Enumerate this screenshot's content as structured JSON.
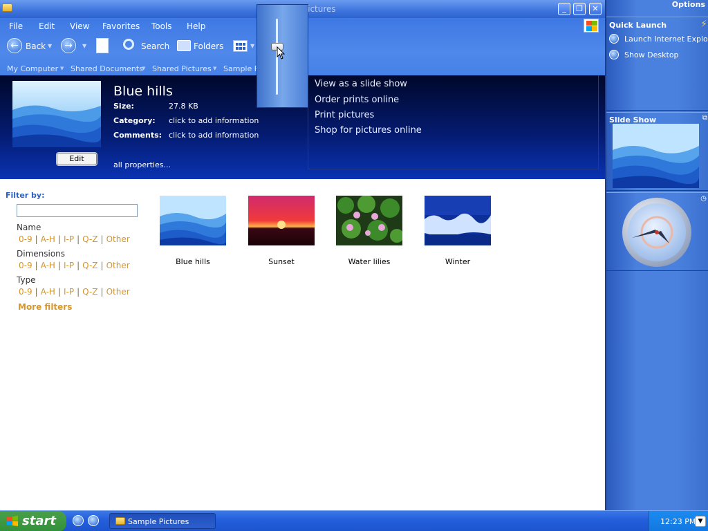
{
  "window": {
    "title": "Sample Pictures"
  },
  "menu": [
    "File",
    "Edit",
    "View",
    "Favorites",
    "Tools",
    "Help"
  ],
  "toolbar": {
    "back_label": "Back",
    "search_label": "Search",
    "folders_label": "Folders"
  },
  "address": [
    "My Computer",
    "Shared Documents",
    "Shared Pictures",
    "Sample Pictures"
  ],
  "details": {
    "title": "Blue hills",
    "size_label": "Size:",
    "size_value": "27.8 KB",
    "category_label": "Category:",
    "category_value": "click to add information",
    "comments_label": "Comments:",
    "comments_value": "click to add information",
    "edit_label": "Edit",
    "all_properties": "all properties..."
  },
  "tasks": [
    "View as a slide show",
    "Order prints online",
    "Print pictures",
    "Shop for pictures online"
  ],
  "filters": {
    "title": "Filter by:",
    "groups": [
      {
        "name": "Name",
        "options": [
          "0-9",
          "A-H",
          "I-P",
          "Q-Z",
          "Other"
        ]
      },
      {
        "name": "Dimensions",
        "options": [
          "0-9",
          "A-H",
          "I-P",
          "Q-Z",
          "Other"
        ]
      },
      {
        "name": "Type",
        "options": [
          "0-9",
          "A-H",
          "I-P",
          "Q-Z",
          "Other"
        ]
      }
    ],
    "more": "More filters"
  },
  "thumbnails": [
    "Blue hills",
    "Sunset",
    "Water lilies",
    "Winter"
  ],
  "sidebar": {
    "options": "Options",
    "quick_launch_title": "Quick Launch",
    "quick_launch_items": [
      "Launch Internet Explorer",
      "Show Desktop"
    ],
    "slide_show_title": "Slide Show"
  },
  "taskbar": {
    "start": "start",
    "task": "Sample Pictures",
    "clock": "12:23 PM"
  }
}
